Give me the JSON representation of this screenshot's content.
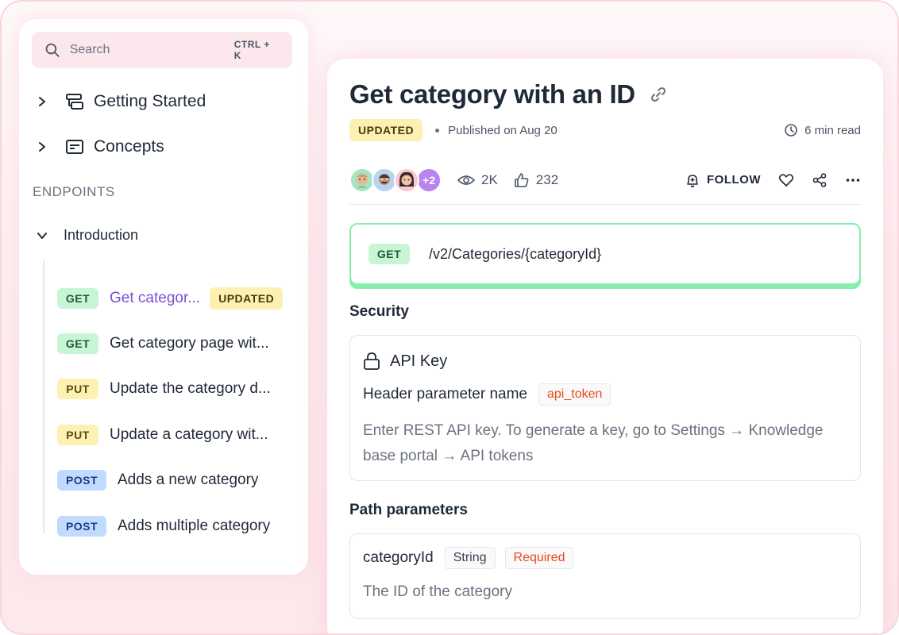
{
  "search": {
    "placeholder": "Search",
    "shortcut": "CTRL + K"
  },
  "sidebar": {
    "top_items": [
      {
        "label": "Getting Started",
        "icon": "stack-icon"
      },
      {
        "label": "Concepts",
        "icon": "card-icon"
      }
    ],
    "section_label": "ENDPOINTS",
    "group": {
      "label": "Introduction"
    },
    "endpoints": [
      {
        "method": "GET",
        "label": "Get categor...",
        "badge": "UPDATED",
        "active": true
      },
      {
        "method": "GET",
        "label": "Get category page wit..."
      },
      {
        "method": "PUT",
        "label": "Update the category d..."
      },
      {
        "method": "PUT",
        "label": "Update a category wit..."
      },
      {
        "method": "POST",
        "label": "Adds a new category"
      },
      {
        "method": "POST",
        "label": "Adds multiple category"
      }
    ]
  },
  "article": {
    "title": "Get category with an ID",
    "badge": "UPDATED",
    "published": "Published on Aug 20",
    "read_time": "6 min read",
    "avatars_more": "+2",
    "views": "2K",
    "likes": "232",
    "follow_label": "FOLLOW"
  },
  "endpoint": {
    "method": "GET",
    "path": "/v2/Categories/{categoryId}"
  },
  "security": {
    "heading": "Security",
    "title": "API Key",
    "header_label": "Header parameter name",
    "header_value": "api_token",
    "description": "Enter REST API key. To generate a key, go to Settings → Knowledge base portal → API tokens"
  },
  "path_params": {
    "heading": "Path parameters",
    "name": "categoryId",
    "type": "String",
    "required": "Required",
    "description": "The ID of the category"
  },
  "colors": {
    "active_link": "#7c4ddd",
    "get": "#c7f5d6",
    "put": "#fdf0b3",
    "post": "#bfdbfe",
    "endpoint_border": "#86efac",
    "required": "#e64a19"
  }
}
